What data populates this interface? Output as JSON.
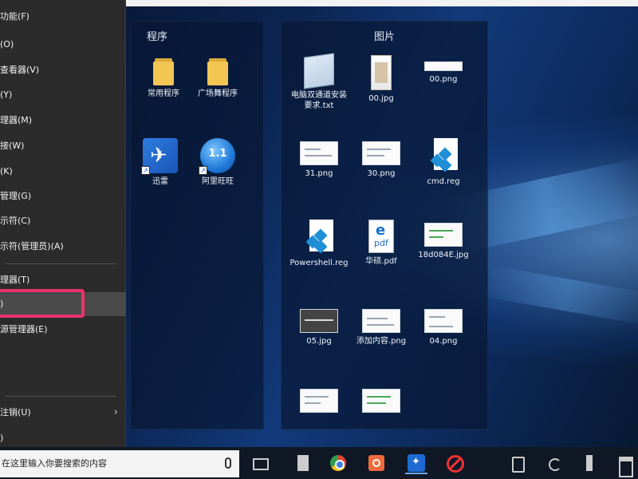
{
  "start_menu_groups": {
    "programs": {
      "title": "程序",
      "items": [
        {
          "label": "常用程序",
          "icon": "folder-icon"
        },
        {
          "label": "广场舞程序",
          "icon": "folder-icon"
        },
        {
          "label": "迅雷",
          "icon": "xunlei-icon"
        },
        {
          "label": "阿里旺旺",
          "icon": "aliwangwang-icon",
          "icon_text": "1.1"
        }
      ]
    },
    "pictures": {
      "title": "图片",
      "items": [
        {
          "label": "电脑双通道安装要求.txt",
          "icon": "text-file-icon"
        },
        {
          "label": "00.jpg",
          "icon": "image-file-icon"
        },
        {
          "label": "00.png",
          "icon": "image-file-icon"
        },
        {
          "label": "31.png",
          "icon": "image-file-icon"
        },
        {
          "label": "30.png",
          "icon": "image-file-icon"
        },
        {
          "label": "cmd.reg",
          "icon": "registry-file-icon"
        },
        {
          "label": "Powershell.reg",
          "icon": "registry-file-icon"
        },
        {
          "label": "华硕.pdf",
          "icon": "pdf-file-icon",
          "icon_text": "e",
          "icon_subtext": "pdf"
        },
        {
          "label": "18d084E.jpg",
          "icon": "image-file-icon"
        },
        {
          "label": "05.jpg",
          "icon": "image-file-icon"
        },
        {
          "label": "添加内容.png",
          "icon": "image-file-icon"
        },
        {
          "label": "04.png",
          "icon": "image-file-icon"
        },
        {
          "label": "",
          "icon": "image-file-icon"
        },
        {
          "label": "",
          "icon": "image-file-icon"
        }
      ]
    }
  },
  "context_menu": {
    "items": [
      {
        "label": "功能(F)"
      },
      {
        "label": "(O)"
      },
      {
        "label": "查看器(V)"
      },
      {
        "label": "(Y)"
      },
      {
        "label": "理器(M)"
      },
      {
        "label": "接(W)"
      },
      {
        "label": "(K)"
      },
      {
        "label": "管理(G)"
      },
      {
        "label": "示符(C)"
      },
      {
        "label": "示符(管理员)(A)"
      },
      {
        "label": "理器(T)"
      },
      {
        "label": ")"
      },
      {
        "label": "源管理器(E)"
      },
      {
        "label": ""
      },
      {
        "label": ""
      },
      {
        "label": "注销(U)",
        "has_submenu": true
      },
      {
        "label": ")"
      }
    ],
    "submenu_arrow": "›"
  },
  "taskbar": {
    "search_placeholder": "在这里输入你要搜索的内容",
    "pinned": [
      "task-view-icon",
      "calculator-icon",
      "chrome-icon",
      "power-icon",
      "xunlei-icon",
      "block-icon"
    ],
    "tray": [
      "tablet-icon",
      "refresh-icon",
      "pen-icon",
      "device-icon"
    ]
  },
  "colors": {
    "highlight_box": "#e8336b",
    "menu_bg": "#2b2b2b",
    "taskbar_bg": "#101826"
  }
}
